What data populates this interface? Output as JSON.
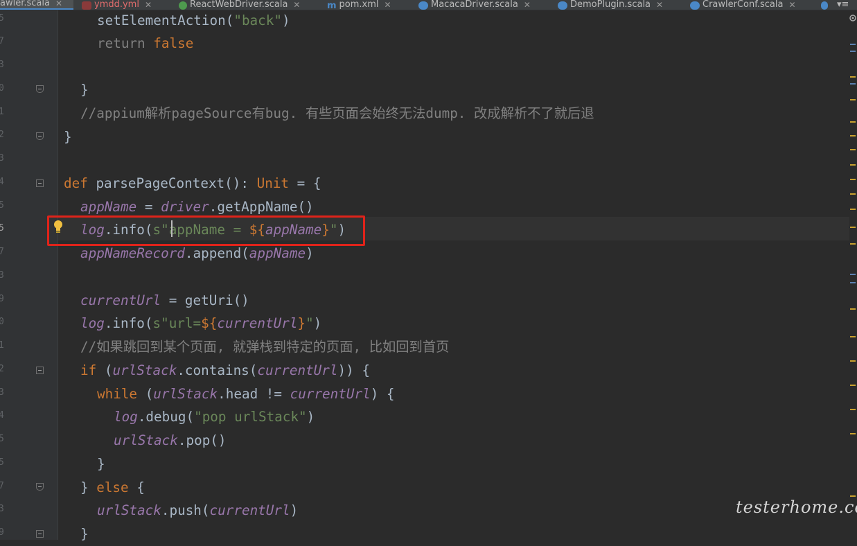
{
  "tabs": [
    {
      "label": "awler.scala",
      "active": true
    },
    {
      "label": "ymdd.yml"
    },
    {
      "label": "ReactWebDriver.scala"
    },
    {
      "label": "pom.xml"
    },
    {
      "label": "MacacaDriver.scala"
    },
    {
      "label": "DemoPlugin.scala"
    },
    {
      "label": "CrawlerConf.scala"
    }
  ],
  "tab_overflow": "▾≡",
  "gutter": {
    "line_numbers": [
      "5",
      "7",
      "3",
      "0",
      "1",
      "2",
      "3",
      "4",
      "5",
      "5",
      "7",
      "3",
      "9",
      "0",
      "1",
      "2",
      "3",
      "4",
      "5",
      "5",
      "7",
      "3",
      "9"
    ]
  },
  "code": {
    "l1": [
      "setElementAction(",
      "\"back\"",
      ")"
    ],
    "l2": [
      "return ",
      "false"
    ],
    "l4": "}",
    "l5": "//appium解析pageSource有bug. 有些页面会始终无法dump. 改成解析不了就后退",
    "l6": "}",
    "l8": [
      "def ",
      "parsePageContext(): ",
      "Unit",
      " = {"
    ],
    "l9": [
      "appName",
      " = ",
      "driver",
      ".getAppName()"
    ],
    "l10": [
      "log",
      ".info(",
      "s\"appName = ",
      "${",
      "appName",
      "}",
      "\"",
      ")"
    ],
    "l11": [
      "appNameRecord",
      ".append(",
      "appName",
      ")"
    ],
    "l13": [
      "currentUrl",
      " = getUri()"
    ],
    "l14": [
      "log",
      ".info(",
      "s\"url=",
      "${",
      "currentUrl",
      "}",
      "\"",
      ")"
    ],
    "l15": "//如果跳回到某个页面, 就弹栈到特定的页面, 比如回到首页",
    "l16": [
      "if ",
      "(",
      "urlStack",
      ".contains(",
      "currentUrl",
      ")) {"
    ],
    "l17": [
      "while ",
      "(",
      "urlStack",
      ".head != ",
      "currentUrl",
      ") {"
    ],
    "l18": [
      "log",
      ".debug(",
      "\"pop urlStack\"",
      ")"
    ],
    "l19": [
      "urlStack",
      ".pop()"
    ],
    "l20": "}",
    "l21": [
      "} ",
      "else",
      " {"
    ],
    "l22": [
      "urlStack",
      ".push(",
      "currentUrl",
      ")"
    ],
    "l23": "}"
  },
  "watermark": "testerhome.com",
  "colors": {
    "background": "#2b2b2b",
    "keyword": "#cc7832",
    "string": "#6a8759",
    "field": "#9876aa",
    "comment": "#808080",
    "default": "#a9b7c6",
    "highlight": "#e0231a"
  }
}
